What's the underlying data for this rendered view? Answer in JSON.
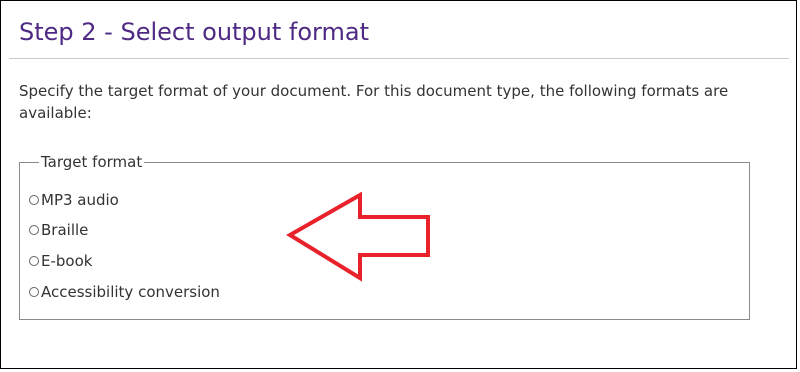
{
  "step": {
    "title": "Step 2 - Select output format",
    "description": "Specify the target format of your document. For this document type, the following formats are available:"
  },
  "target_format": {
    "legend": "Target format",
    "options": [
      {
        "label": "MP3 audio",
        "checked": false
      },
      {
        "label": "Braille",
        "checked": false
      },
      {
        "label": "E-book",
        "checked": false
      },
      {
        "label": "Accessibility conversion",
        "checked": false
      }
    ]
  },
  "annotation": {
    "arrow_color": "#e8212b",
    "arrow_icon": "left-arrow-icon"
  },
  "colors": {
    "title": "#4e2a84",
    "text": "#333333",
    "border": "#8a8a8a"
  }
}
